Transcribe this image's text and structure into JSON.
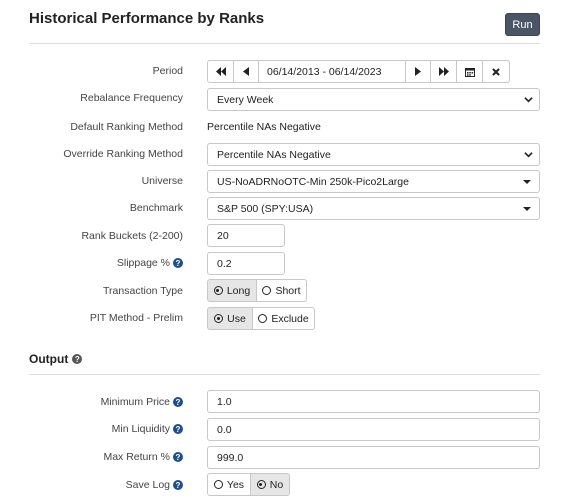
{
  "page": {
    "title": "Historical Performance by Ranks",
    "run_label": "Run"
  },
  "fields": {
    "period": {
      "label": "Period",
      "value": "06/14/2013 - 06/14/2023",
      "buttons": [
        "first-icon",
        "prev-icon",
        "next-icon",
        "last-icon",
        "calendar-icon",
        "clear-icon"
      ]
    },
    "rebalance": {
      "label": "Rebalance Frequency",
      "value": "Every Week"
    },
    "default_ranking": {
      "label": "Default Ranking Method",
      "value": "Percentile NAs Negative"
    },
    "override_ranking": {
      "label": "Override Ranking Method",
      "value": "Percentile NAs Negative"
    },
    "universe": {
      "label": "Universe",
      "value": "US-NoADRNoOTC-Min 250k-Pico2Large"
    },
    "benchmark": {
      "label": "Benchmark",
      "value": "S&P 500 (SPY:USA)"
    },
    "rank_buckets": {
      "label": "Rank Buckets (2-200)",
      "value": "20"
    },
    "slippage": {
      "label": "Slippage %",
      "value": "0.2"
    },
    "transaction_type": {
      "label": "Transaction Type",
      "options": [
        "Long",
        "Short"
      ],
      "selected": "Long"
    },
    "pit_method": {
      "label": "PIT Method - Prelim",
      "options": [
        "Use",
        "Exclude"
      ],
      "selected": "Use"
    }
  },
  "output": {
    "title": "Output",
    "min_price": {
      "label": "Minimum Price",
      "value": "1.0"
    },
    "min_liquidity": {
      "label": "Min Liquidity",
      "value": "0.0"
    },
    "max_return": {
      "label": "Max Return %",
      "value": "999.0"
    },
    "save_log": {
      "label": "Save Log",
      "options": [
        "Yes",
        "No"
      ],
      "selected": "No"
    }
  },
  "colors": {
    "run_button": "#4a5566",
    "help_icon": "#1f4f8a",
    "active_toggle": "#e6e6e6"
  }
}
